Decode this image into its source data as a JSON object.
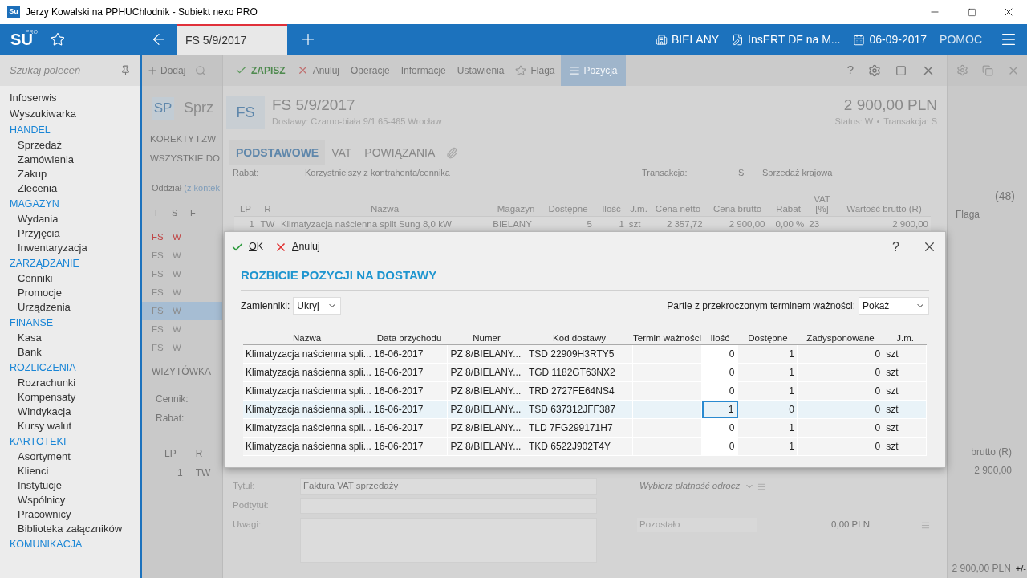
{
  "window": {
    "app_icon": "Su",
    "title": "Jerzy Kowalski na PPHUChlodnik - Subiekt nexo PRO"
  },
  "header": {
    "logo": "SU",
    "logo_badge": "PRO",
    "tabs": [
      {
        "label": "FS 5/9/2017",
        "selected": true
      }
    ],
    "context": [
      {
        "kind": "branch",
        "label": "BIELANY"
      },
      {
        "kind": "company",
        "label": "InsERT DF na M..."
      },
      {
        "kind": "date",
        "label": "06-09-2017"
      }
    ],
    "help": "POMOC"
  },
  "sidebar": {
    "search_placeholder": "Szukaj poleceń",
    "items": [
      {
        "kind": "link",
        "label": "Infoserwis"
      },
      {
        "kind": "link",
        "label": "Wyszukiwarka"
      },
      {
        "kind": "section",
        "label": "HANDEL"
      },
      {
        "kind": "item",
        "label": "Sprzedaż"
      },
      {
        "kind": "item",
        "label": "Zamówienia"
      },
      {
        "kind": "item",
        "label": "Zakup"
      },
      {
        "kind": "item",
        "label": "Zlecenia"
      },
      {
        "kind": "section",
        "label": "MAGAZYN"
      },
      {
        "kind": "item",
        "label": "Wydania"
      },
      {
        "kind": "item",
        "label": "Przyjęcia"
      },
      {
        "kind": "item",
        "label": "Inwentaryzacja"
      },
      {
        "kind": "section",
        "label": "ZARZĄDZANIE"
      },
      {
        "kind": "item",
        "label": "Cenniki"
      },
      {
        "kind": "item",
        "label": "Promocje"
      },
      {
        "kind": "item",
        "label": "Urządzenia"
      },
      {
        "kind": "section",
        "label": "FINANSE"
      },
      {
        "kind": "item",
        "label": "Kasa"
      },
      {
        "kind": "item",
        "label": "Bank"
      },
      {
        "kind": "section",
        "label": "ROZLICZENIA"
      },
      {
        "kind": "item",
        "label": "Rozrachunki"
      },
      {
        "kind": "item",
        "label": "Kompensaty"
      },
      {
        "kind": "item",
        "label": "Windykacja"
      },
      {
        "kind": "item",
        "label": "Kursy walut"
      },
      {
        "kind": "section",
        "label": "KARTOTEKI"
      },
      {
        "kind": "item",
        "label": "Asortyment"
      },
      {
        "kind": "item",
        "label": "Klienci"
      },
      {
        "kind": "item",
        "label": "Instytucje"
      },
      {
        "kind": "item",
        "label": "Wspólnicy"
      },
      {
        "kind": "item",
        "label": "Pracownicy"
      },
      {
        "kind": "item",
        "label": "Biblioteka załączników"
      },
      {
        "kind": "section",
        "label": "KOMUNIKACJA"
      }
    ]
  },
  "list_window": {
    "add": "Dodaj",
    "badge": "SP",
    "title": "Sprz",
    "filters": [
      "KOREKTY I ZW",
      "WSZYSTKIE DO"
    ],
    "branch_label": "Oddział",
    "branch_link": "(z kontek",
    "columns": [
      "T",
      "S",
      "F"
    ],
    "rows": [
      {
        "type": "FS",
        "status": "W",
        "selected": false,
        "color": "#c04848"
      },
      {
        "type": "FS",
        "status": "W",
        "selected": false,
        "color": "#8c8c8c"
      },
      {
        "type": "FS",
        "status": "W",
        "selected": false,
        "color": "#8c8c8c"
      },
      {
        "type": "FS",
        "status": "W",
        "selected": false,
        "color": "#8c8c8c"
      },
      {
        "type": "FS",
        "status": "W",
        "selected": true,
        "color": "#8c8c8c"
      },
      {
        "type": "FS",
        "status": "W",
        "selected": false,
        "color": "#8c8c8c"
      },
      {
        "type": "FS",
        "status": "W",
        "selected": false,
        "color": "#8c8c8c"
      }
    ],
    "count": "(48)",
    "flag_column": "Flaga",
    "card_title": "WIZYTÓWKA",
    "card_fields": [
      "Cennik:",
      "Rabat:"
    ],
    "detail_columns": [
      "LP",
      "R"
    ],
    "detail_row": [
      "1",
      "TW"
    ],
    "detail_value_header": "brutto (R)",
    "detail_value": "2 900,00",
    "total": "2 900,00 PLN",
    "sign_toggle": "+/-"
  },
  "document": {
    "toolbar": [
      {
        "kind": "save",
        "label": "ZAPISZ",
        "selected": false
      },
      {
        "kind": "cancel",
        "label": "Anuluj",
        "selected": false
      },
      {
        "kind": "menu",
        "label": "Operacje",
        "selected": false
      },
      {
        "kind": "menu",
        "label": "Informacje",
        "selected": false
      },
      {
        "kind": "menu",
        "label": "Ustawienia",
        "selected": false
      },
      {
        "kind": "flag",
        "label": "Flaga",
        "selected": false
      },
      {
        "kind": "position",
        "label": "Pozycja",
        "selected": true
      }
    ],
    "help": "?",
    "badge": "FS",
    "title": "FS 5/9/2017",
    "subtitle": "Dostawy: Czarno-biała 9/1 65-465 Wrocław",
    "amount": "2 900,00 PLN",
    "status": "Status: W",
    "transaction": "Transakcja: S",
    "tabs": [
      {
        "label": "PODSTAWOWE",
        "selected": true
      },
      {
        "label": "VAT",
        "selected": false
      },
      {
        "label": "POWIĄZANIA",
        "selected": false
      }
    ],
    "discount": {
      "label": "Rabat:",
      "value": "Korzystniejszy z kontrahenta/cennika"
    },
    "transaction_type": {
      "label": "Transakcja:",
      "code": "S",
      "value": "Sprzedaż krajowa"
    },
    "items_columns": [
      "LP",
      "R",
      "Nazwa",
      "Magazyn",
      "Dostępne",
      "Ilość",
      "J.m.",
      "Cena netto",
      "Cena brutto",
      "Rabat",
      "VAT [%]",
      "Wartość brutto (R)"
    ],
    "items_rows": [
      [
        "1",
        "TW",
        "Klimatyzacja naścienna split Sung 8,0 kW",
        "BIELANY",
        "5",
        "1",
        "szt",
        "2 357,72",
        "2 900,00",
        "0,00 %",
        "23",
        "2 900,00"
      ]
    ],
    "title_field": {
      "label": "Tytuł:",
      "value": "Faktura VAT sprzedaży"
    },
    "subtitle_label": "Podtytuł:",
    "notes_label": "Uwagi:",
    "payment": {
      "placeholder": "Wybierz płatność odrocz"
    },
    "remaining": {
      "label": "Pozostało",
      "value": "0,00 PLN"
    }
  },
  "dialog": {
    "actions": [
      {
        "kind": "ok",
        "label": "OK"
      },
      {
        "kind": "cancel",
        "label": "Anuluj"
      }
    ],
    "help": "?",
    "title": "ROZBICIE POZYCJI NA DOSTAWY",
    "substitutes": {
      "label": "Zamienniki:",
      "value": "Ukryj"
    },
    "expired": {
      "label": "Partie z przekroczonym terminem ważności:",
      "value": "Pokaż"
    },
    "columns": [
      "Nazwa",
      "Data przychodu",
      "Numer",
      "Kod dostawy",
      "Termin ważności",
      "Ilość",
      "Dostępne",
      "Zadysponowane",
      "J.m."
    ],
    "rows": [
      {
        "name": "Klimatyzacja naścienna spli...",
        "date": "16-06-2017",
        "number": "PZ 8/BIELANY...",
        "code": "TSD 22909H3RTY5",
        "qty": "0",
        "available": "1",
        "allocated": "0",
        "unit": "szt",
        "selected": false
      },
      {
        "name": "Klimatyzacja naścienna spli...",
        "date": "16-06-2017",
        "number": "PZ 8/BIELANY...",
        "code": "TGD 1182GT63NX2",
        "qty": "0",
        "available": "1",
        "allocated": "0",
        "unit": "szt",
        "selected": false
      },
      {
        "name": "Klimatyzacja naścienna spli...",
        "date": "16-06-2017",
        "number": "PZ 8/BIELANY...",
        "code": "TRD 2727FE64NS4",
        "qty": "0",
        "available": "1",
        "allocated": "0",
        "unit": "szt",
        "selected": false
      },
      {
        "name": "Klimatyzacja naścienna spli...",
        "date": "16-06-2017",
        "number": "PZ 8/BIELANY...",
        "code": "TSD 637312JFF387",
        "qty": "1",
        "available": "0",
        "allocated": "0",
        "unit": "szt",
        "selected": true
      },
      {
        "name": "Klimatyzacja naścienna spli...",
        "date": "16-06-2017",
        "number": "PZ 8/BIELANY...",
        "code": "TLD 7FG299171H7",
        "qty": "0",
        "available": "1",
        "allocated": "0",
        "unit": "szt",
        "selected": false
      },
      {
        "name": "Klimatyzacja naścienna spli...",
        "date": "16-06-2017",
        "number": "PZ 8/BIELANY...",
        "code": "TKD 6522J902T4Y",
        "qty": "0",
        "available": "1",
        "allocated": "0",
        "unit": "szt",
        "selected": false
      }
    ]
  }
}
